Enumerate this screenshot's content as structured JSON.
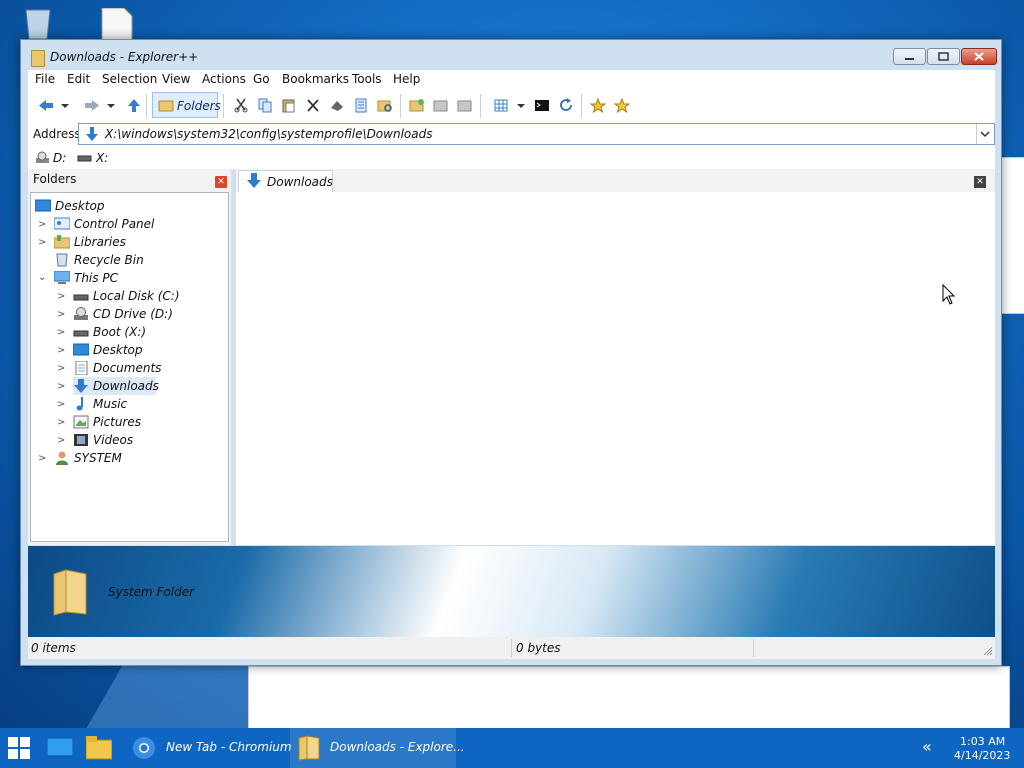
{
  "window": {
    "title": "Downloads - Explorer++"
  },
  "menu": [
    "File",
    "Edit",
    "Selection",
    "View",
    "Actions",
    "Go",
    "Bookmarks",
    "Tools",
    "Help"
  ],
  "toolbar": {
    "folders_label": "Folders"
  },
  "address": {
    "label": "Address",
    "value": "X:\\windows\\system32\\config\\systemprofile\\Downloads"
  },
  "drives": [
    "D:",
    "X:"
  ],
  "tree": {
    "title": "Folders",
    "items": [
      {
        "label": "Desktop",
        "icon": "desktop-icon"
      },
      {
        "label": "Control Panel",
        "icon": "control-panel-icon"
      },
      {
        "label": "Libraries",
        "icon": "libraries-icon"
      },
      {
        "label": "Recycle Bin",
        "icon": "recycle-bin-icon"
      },
      {
        "label": "This PC",
        "icon": "computer-icon"
      },
      {
        "label": "Local Disk (C:)",
        "icon": "hard-drive-icon"
      },
      {
        "label": "CD Drive (D:)",
        "icon": "cd-drive-icon"
      },
      {
        "label": "Boot (X:)",
        "icon": "hard-drive-icon"
      },
      {
        "label": "Desktop",
        "icon": "desktop-icon"
      },
      {
        "label": "Documents",
        "icon": "documents-icon"
      },
      {
        "label": "Downloads",
        "icon": "download-arrow-icon"
      },
      {
        "label": "Music",
        "icon": "music-note-icon"
      },
      {
        "label": "Pictures",
        "icon": "pictures-icon"
      },
      {
        "label": "Videos",
        "icon": "videos-icon"
      },
      {
        "label": "SYSTEM",
        "icon": "user-icon"
      }
    ]
  },
  "tab": {
    "label": "Downloads"
  },
  "display_panel": {
    "text": "System Folder"
  },
  "status": {
    "items": "0 items",
    "size": "0 bytes"
  },
  "taskbar": {
    "chromium": "New Tab - Chromium",
    "explorer": "Downloads - Explore...",
    "time": "1:03 AM",
    "date": "4/14/2023"
  },
  "colors": {
    "accent": "#0e66c2",
    "close_red": "#c8412b",
    "selected": "#dceaf8"
  }
}
